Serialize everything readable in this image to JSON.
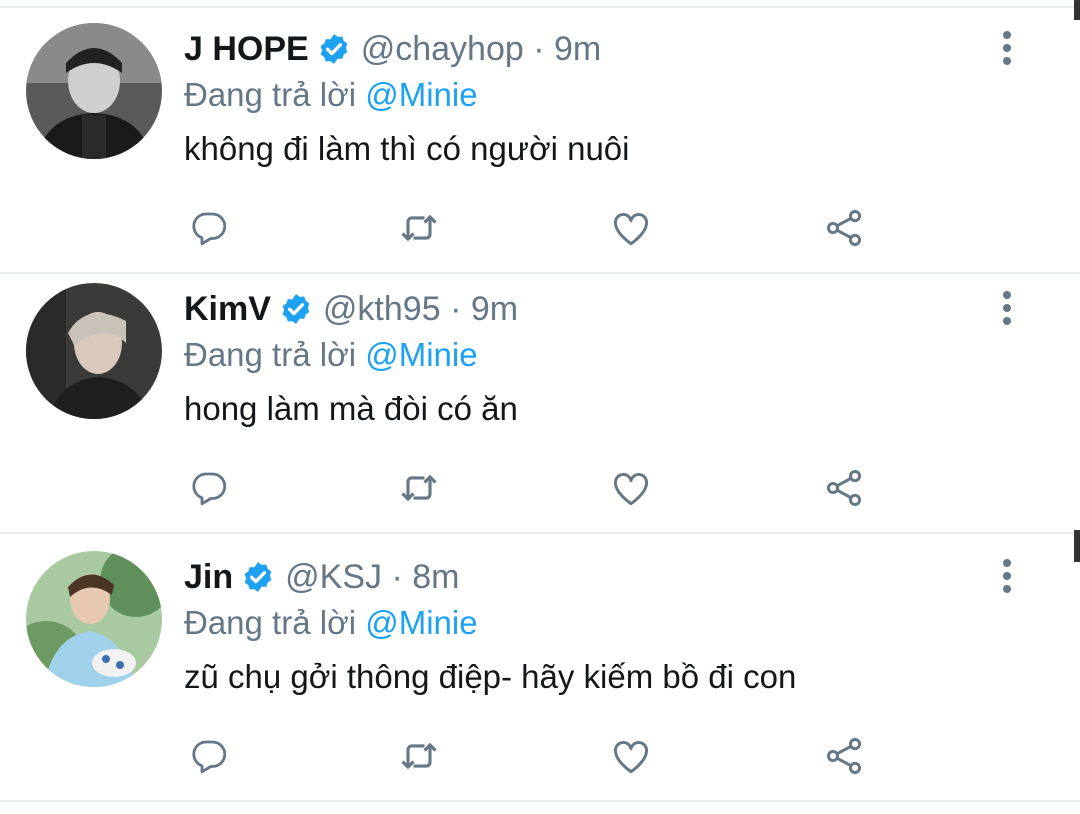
{
  "colors": {
    "accent": "#1da1f2",
    "secondary_text": "#657786",
    "primary_text": "#14171a",
    "divider": "#e6ecf0"
  },
  "tweets": [
    {
      "name": "J HOPE",
      "handle": "@chayhop",
      "time": "· 9m",
      "replying_prefix": "Đang trả lời",
      "replying_to": "@Minie",
      "text": "không đi làm thì có người nuôi",
      "avatar": "grayscale-portrait"
    },
    {
      "name": "KimV",
      "handle": "@kth95",
      "time": "· 9m",
      "replying_prefix": "Đang trả lời",
      "replying_to": "@Minie",
      "text": "hong làm mà đòi có ăn",
      "avatar": "dark-portrait"
    },
    {
      "name": "Jin",
      "handle": "@KSJ",
      "time": "· 8m",
      "replying_prefix": "Đang trả lời",
      "replying_to": "@Minie",
      "text": "zũ chụ gởi thông điệp- hãy kiếm bồ đi con",
      "avatar": "outdoor-portrait"
    }
  ],
  "icons": {
    "verified": "verified-badge-icon",
    "more": "more-vertical-icon",
    "reply": "reply-icon",
    "retweet": "retweet-icon",
    "like": "heart-icon",
    "share": "share-icon"
  }
}
